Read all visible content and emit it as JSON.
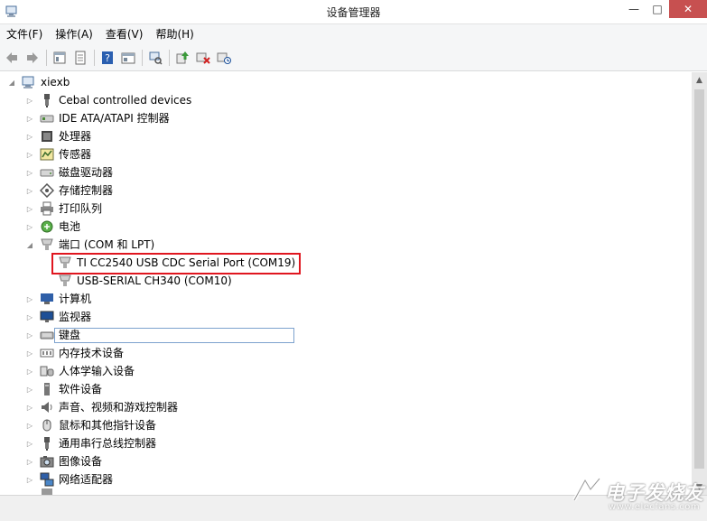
{
  "window": {
    "title": "设备管理器",
    "min_glyph": "—",
    "max_glyph": "□",
    "close_glyph": "✕"
  },
  "menu": [
    "文件(F)",
    "操作(A)",
    "查看(V)",
    "帮助(H)"
  ],
  "toolbar": [
    "back-icon",
    "forward-icon",
    "properties-view-icon",
    "page-icon",
    "help-icon",
    "details-icon",
    "scan-hardware-icon",
    "update-driver-icon",
    "disable-device-icon",
    "uninstall-device-icon"
  ],
  "tree": {
    "root": "xiexb",
    "categories": [
      "Cebal controlled devices",
      "IDE ATA/ATAPI 控制器",
      "处理器",
      "传感器",
      "磁盘驱动器",
      "存储控制器",
      "打印队列",
      "电池",
      "端口 (COM 和 LPT)",
      "TI CC2540 USB CDC Serial Port (COM19)",
      "USB-SERIAL CH340 (COM10)",
      "计算机",
      "监视器",
      "键盘",
      "内存技术设备",
      "人体学输入设备",
      "软件设备",
      "声音、视频和游戏控制器",
      "鼠标和其他指针设备",
      "通用串行总线控制器",
      "图像设备",
      "网络适配器"
    ]
  },
  "toggles": {
    "expanded": "◢",
    "collapsed": "▷"
  },
  "scrollbar": {
    "up": "▲",
    "down": "▼"
  },
  "watermark": {
    "text": "电子发烧友",
    "url": "www.elecfans.com"
  }
}
